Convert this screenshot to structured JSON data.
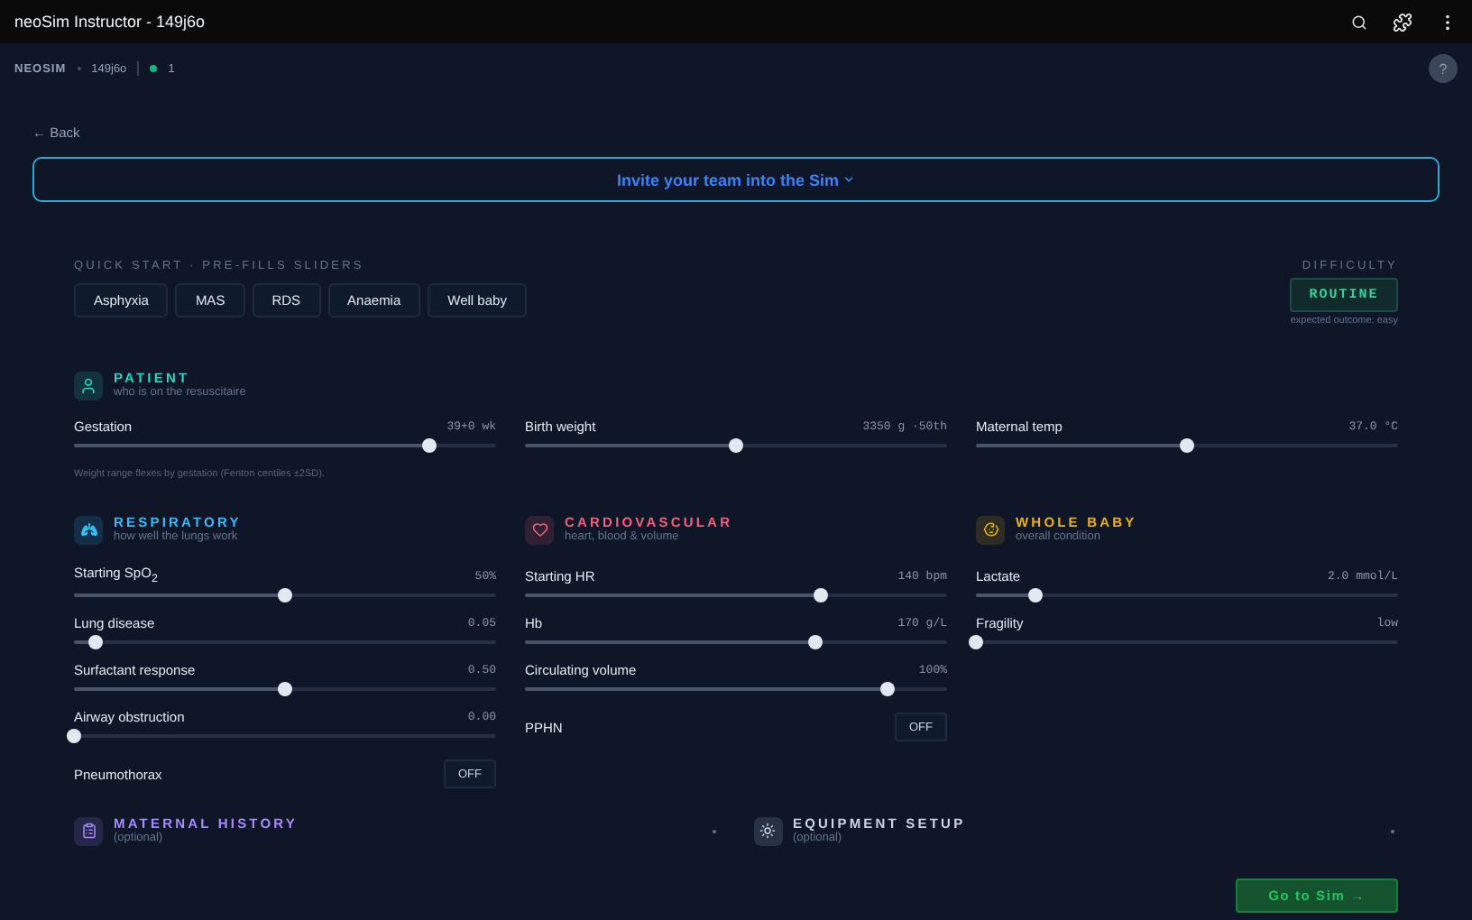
{
  "window": {
    "title": "neoSim Instructor - 149j6o"
  },
  "header": {
    "brand": "NEOSIM",
    "session": "149j6o",
    "participants": "1",
    "help": "?"
  },
  "back": "← Back",
  "invite": {
    "label": "Invite your team into the Sim",
    "expanded": false
  },
  "quick_start": {
    "label": "QUICK START · PRE-FILLS SLIDERS",
    "presets": [
      {
        "label": "Asphyxia",
        "selected": false
      },
      {
        "label": "MAS",
        "selected": false
      },
      {
        "label": "RDS",
        "selected": false
      },
      {
        "label": "Anaemia",
        "selected": false
      },
      {
        "label": "Well baby",
        "selected": false
      }
    ]
  },
  "difficulty": {
    "label": "DIFFICULTY",
    "value": "ROUTINE",
    "outcome": "expected outcome: easy"
  },
  "patient": {
    "title": "PATIENT",
    "subtitle": "who is on the resuscitaire",
    "color": "#2dd4bf",
    "sliders": [
      {
        "label": "Gestation",
        "reading": "39+0 wk",
        "level": 0.84
      },
      {
        "label": "Birth weight",
        "reading": "3350 g ·50th",
        "level": 0.5
      },
      {
        "label": "Maternal temp",
        "reading": "37.0 °C",
        "level": 0.5
      }
    ],
    "note": "Weight range flexes by gestation (Fenton centiles ±2SD)."
  },
  "systems": [
    {
      "title": "RESPIRATORY",
      "subtitle": "how well the lungs work",
      "color": "#38bdf8",
      "controls": [
        {
          "kind": "slider",
          "label": "Starting SpO$_{2}$",
          "reading": "50%",
          "level": 0.5
        },
        {
          "kind": "slider",
          "label": "Lung disease",
          "reading": "0.05",
          "level": 0.05
        },
        {
          "kind": "slider",
          "label": "Surfactant response",
          "reading": "0.50",
          "level": 0.5
        },
        {
          "kind": "slider",
          "label": "Airway obstruction",
          "reading": "0.00",
          "level": 0
        },
        {
          "kind": "toggle",
          "label": "Pneumothorax",
          "value": "OFF",
          "on": false
        }
      ]
    },
    {
      "title": "CARDIOVASCULAR",
      "subtitle": "heart, blood & volume",
      "color": "#f4607a",
      "controls": [
        {
          "kind": "slider",
          "label": "Starting HR",
          "reading": "140 bpm",
          "level": 0.7
        },
        {
          "kind": "slider",
          "label": "Hb",
          "reading": "170 g/L",
          "level": 0.69
        },
        {
          "kind": "slider",
          "label": "Circulating volume",
          "reading": "100%",
          "level": 0.86
        },
        {
          "kind": "toggle",
          "label": "PPHN",
          "value": "OFF",
          "on": false
        }
      ]
    },
    {
      "title": "WHOLE BABY",
      "subtitle": "overall condition",
      "color": "#eab308",
      "controls": [
        {
          "kind": "slider",
          "label": "Lactate",
          "reading": "2.0 mmol/L",
          "level": 0.14
        },
        {
          "kind": "slider",
          "label": "Fragility",
          "reading": "low",
          "level": 0
        }
      ]
    }
  ],
  "optional_sections": [
    {
      "title": "MATERNAL HISTORY",
      "subtitle": "(optional)",
      "color": "#a78bfa",
      "expanded": false
    },
    {
      "title": "EQUIPMENT SETUP",
      "subtitle": "(optional)",
      "color": "#cbd5e1",
      "expanded": false
    }
  ],
  "go_button": "Go to Sim →"
}
